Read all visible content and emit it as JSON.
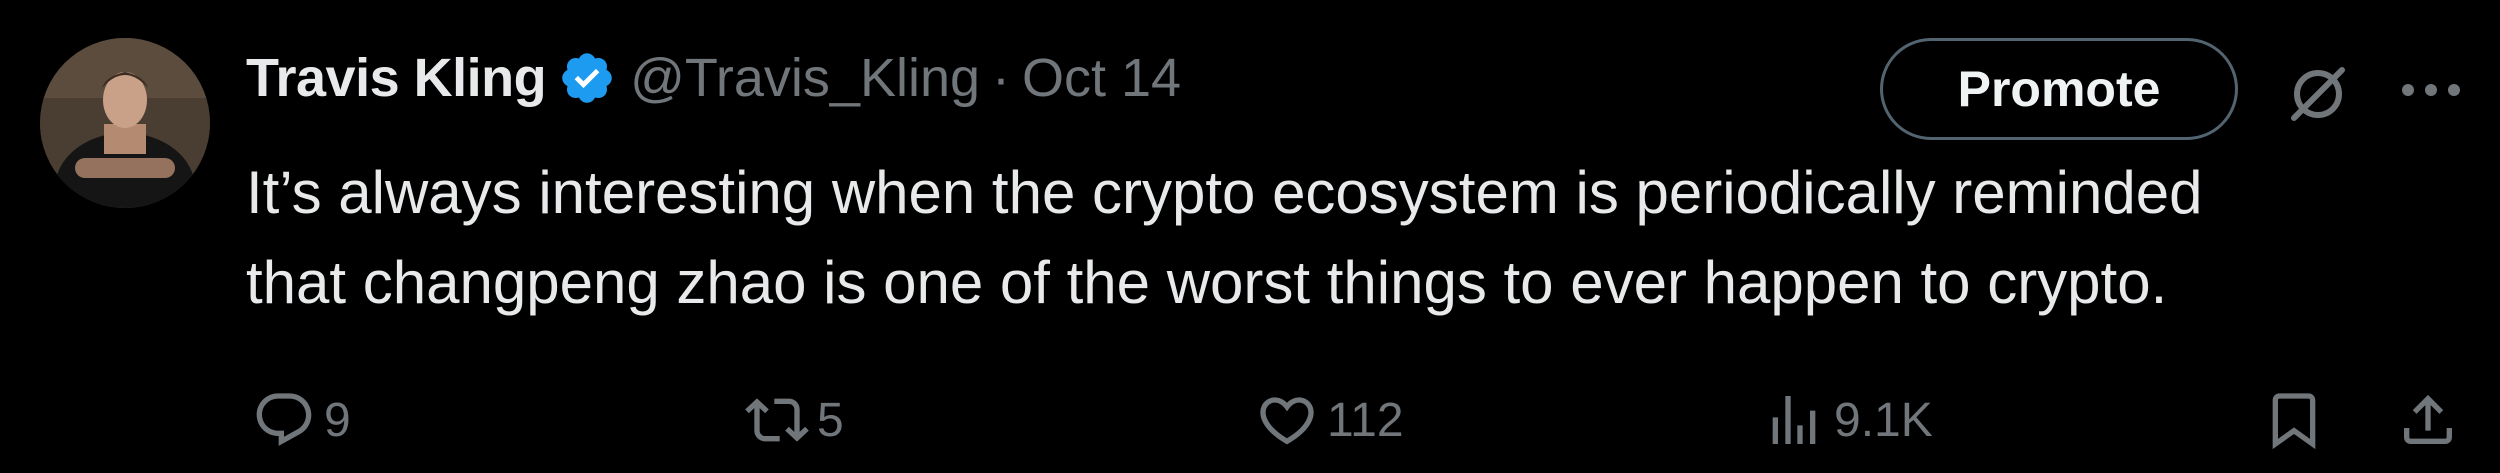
{
  "tweet": {
    "author": {
      "display_name": "Travis Kling",
      "handle": "@Travis_Kling",
      "verified": true,
      "avatar_icon": "profile-photo"
    },
    "separator": "·",
    "date": "Oct 14",
    "promote_label": "Promote",
    "text_lines": [
      "It’s always interesting when the crypto ecosystem is periodically reminded",
      "that changpeng zhao is one of the worst things to ever happen to crypto."
    ],
    "metrics": {
      "replies": "9",
      "reposts": "5",
      "likes": "112",
      "views": "9.1K"
    }
  },
  "colors": {
    "background": "#000000",
    "primary_text": "#e7e9ea",
    "secondary_text": "#71767b",
    "verified_blue": "#1d9bf0",
    "button_border": "#536471"
  },
  "icons": {
    "reply": "reply-bubble-icon",
    "repost": "repost-arrows-icon",
    "like": "heart-icon",
    "views": "bar-chart-icon",
    "bookmark": "bookmark-icon",
    "share": "share-upload-icon",
    "grok": "grok-slash-icon",
    "more": "more-dots-icon"
  }
}
